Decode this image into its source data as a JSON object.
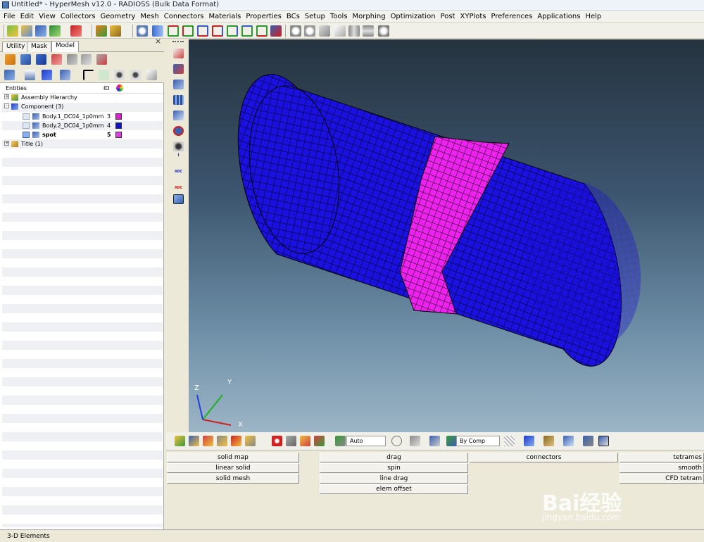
{
  "window": {
    "title": "Untitled* - HyperMesh v12.0 - RADIOSS (Bulk Data Format)"
  },
  "menu": [
    "File",
    "Edit",
    "View",
    "Collectors",
    "Geometry",
    "Mesh",
    "Connectors",
    "Materials",
    "Properties",
    "BCs",
    "Setup",
    "Tools",
    "Morphing",
    "Optimization",
    "Post",
    "XYPlots",
    "Preferences",
    "Applications",
    "Help"
  ],
  "panel": {
    "tabs": [
      "Utility",
      "Mask",
      "Model"
    ],
    "active_tab": "Model",
    "close": "×",
    "columns": {
      "entities": "Entities",
      "id": "ID"
    },
    "tree": [
      {
        "label": "Assembly Hierarchy",
        "id": "",
        "color": "",
        "expander": "+"
      },
      {
        "label": "Component (3)",
        "id": "",
        "color": "",
        "expander": "-"
      },
      {
        "label": "Body.1_DC04_1p0mm",
        "id": "3",
        "color": "#e020d0"
      },
      {
        "label": "Body.2_DC04_1p0mm",
        "id": "4",
        "color": "#1010d0"
      },
      {
        "label": "spot",
        "id": "5",
        "color": "#e040e0"
      },
      {
        "label": "Title (1)",
        "id": "",
        "color": "",
        "expander": "+"
      }
    ]
  },
  "viewport": {
    "axes": {
      "x": "X",
      "y": "Y",
      "z": "Z"
    },
    "colors": {
      "body": "#1a10e0",
      "ring": "#ee22ee",
      "mesh": "#000000"
    }
  },
  "bottom_toolbar": {
    "auto_label": "Auto",
    "color_mode_label": "By Comp"
  },
  "panel_buttons": {
    "col1": [
      "solid map",
      "linear solid",
      "solid mesh"
    ],
    "col2": [
      "drag",
      "spin",
      "line drag",
      "elem offset"
    ],
    "col3": [
      "connectors"
    ],
    "col4": [
      "tetrames",
      "smooth",
      "CFD tetram"
    ]
  },
  "status": {
    "text": "3-D Elements"
  },
  "watermark": {
    "brand": "Bai经验",
    "url": "jingyan.baidu.com"
  }
}
